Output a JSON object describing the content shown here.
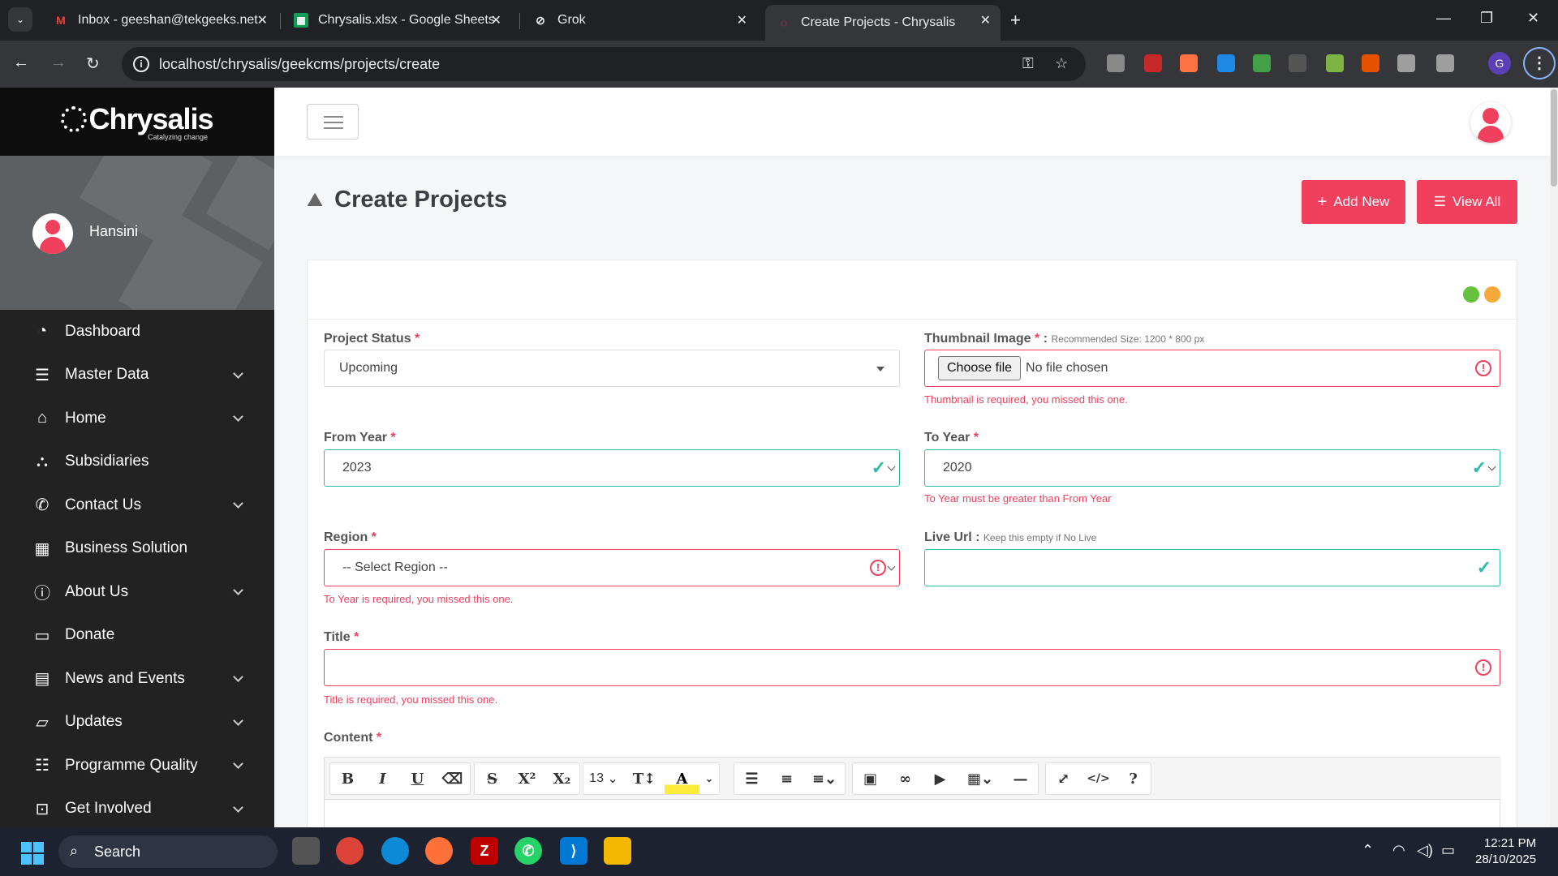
{
  "browser": {
    "tabs": [
      {
        "title": "Inbox - geeshan@tekgeeks.net",
        "icon": "gmail-icon"
      },
      {
        "title": "Chrysalis.xlsx - Google Sheets",
        "icon": "sheets-icon"
      },
      {
        "title": "Grok",
        "icon": "grok-icon"
      },
      {
        "title": "Create Projects - Chrysalis",
        "icon": "chrysalis-icon",
        "active": true
      }
    ],
    "url": "localhost/chrysalis/geekcms/projects/create",
    "profile_initial": "G"
  },
  "sidebar": {
    "logo": "Chrysalis",
    "logo_tagline": "Catalyzing change",
    "username": "Hansini",
    "items": [
      {
        "label": "Dashboard",
        "icon": "pie-chart-icon",
        "expandable": false
      },
      {
        "label": "Master Data",
        "icon": "list-icon",
        "expandable": true
      },
      {
        "label": "Home",
        "icon": "home-icon",
        "expandable": true
      },
      {
        "label": "Subsidiaries",
        "icon": "sitemap-icon",
        "expandable": false
      },
      {
        "label": "Contact Us",
        "icon": "phone-icon",
        "expandable": true
      },
      {
        "label": "Business Solution",
        "icon": "building-icon",
        "expandable": false
      },
      {
        "label": "About Us",
        "icon": "info-icon",
        "expandable": true
      },
      {
        "label": "Donate",
        "icon": "credit-card-icon",
        "expandable": false
      },
      {
        "label": "News and Events",
        "icon": "newspaper-icon",
        "expandable": true
      },
      {
        "label": "Updates",
        "icon": "folder-icon",
        "expandable": true
      },
      {
        "label": "Programme Quality",
        "icon": "checklist-icon",
        "expandable": true
      },
      {
        "label": "Get Involved",
        "icon": "briefcase-icon",
        "expandable": true
      }
    ]
  },
  "page": {
    "title": "Create Projects",
    "add_new_label": "Add New",
    "view_all_label": "View All"
  },
  "form": {
    "project_status": {
      "label": "Project Status",
      "value": "Upcoming"
    },
    "thumbnail": {
      "label": "Thumbnail Image",
      "hint": "Recommended Size: 1200 * 800 px",
      "button": "Choose file",
      "value": "No file chosen",
      "error": "Thumbnail is required, you missed this one."
    },
    "from_year": {
      "label": "From Year",
      "value": "2023"
    },
    "to_year": {
      "label": "To Year",
      "value": "2020",
      "error": "To Year must be greater than From Year"
    },
    "region": {
      "label": "Region",
      "value": "-- Select Region --",
      "error": "To Year is required, you missed this one."
    },
    "live_url": {
      "label": "Live Url",
      "hint": "Keep this empty if No Live",
      "value": ""
    },
    "title": {
      "label": "Title",
      "value": "",
      "error": "Title is required, you missed this one."
    },
    "content": {
      "label": "Content",
      "font_size": "13"
    }
  },
  "colors": {
    "accent": "#f0405e",
    "success": "#2bbbad",
    "sidebar_bg": "#222222"
  },
  "taskbar": {
    "search_label": "Search",
    "time": "12:21 PM",
    "date": "28/10/2025"
  }
}
